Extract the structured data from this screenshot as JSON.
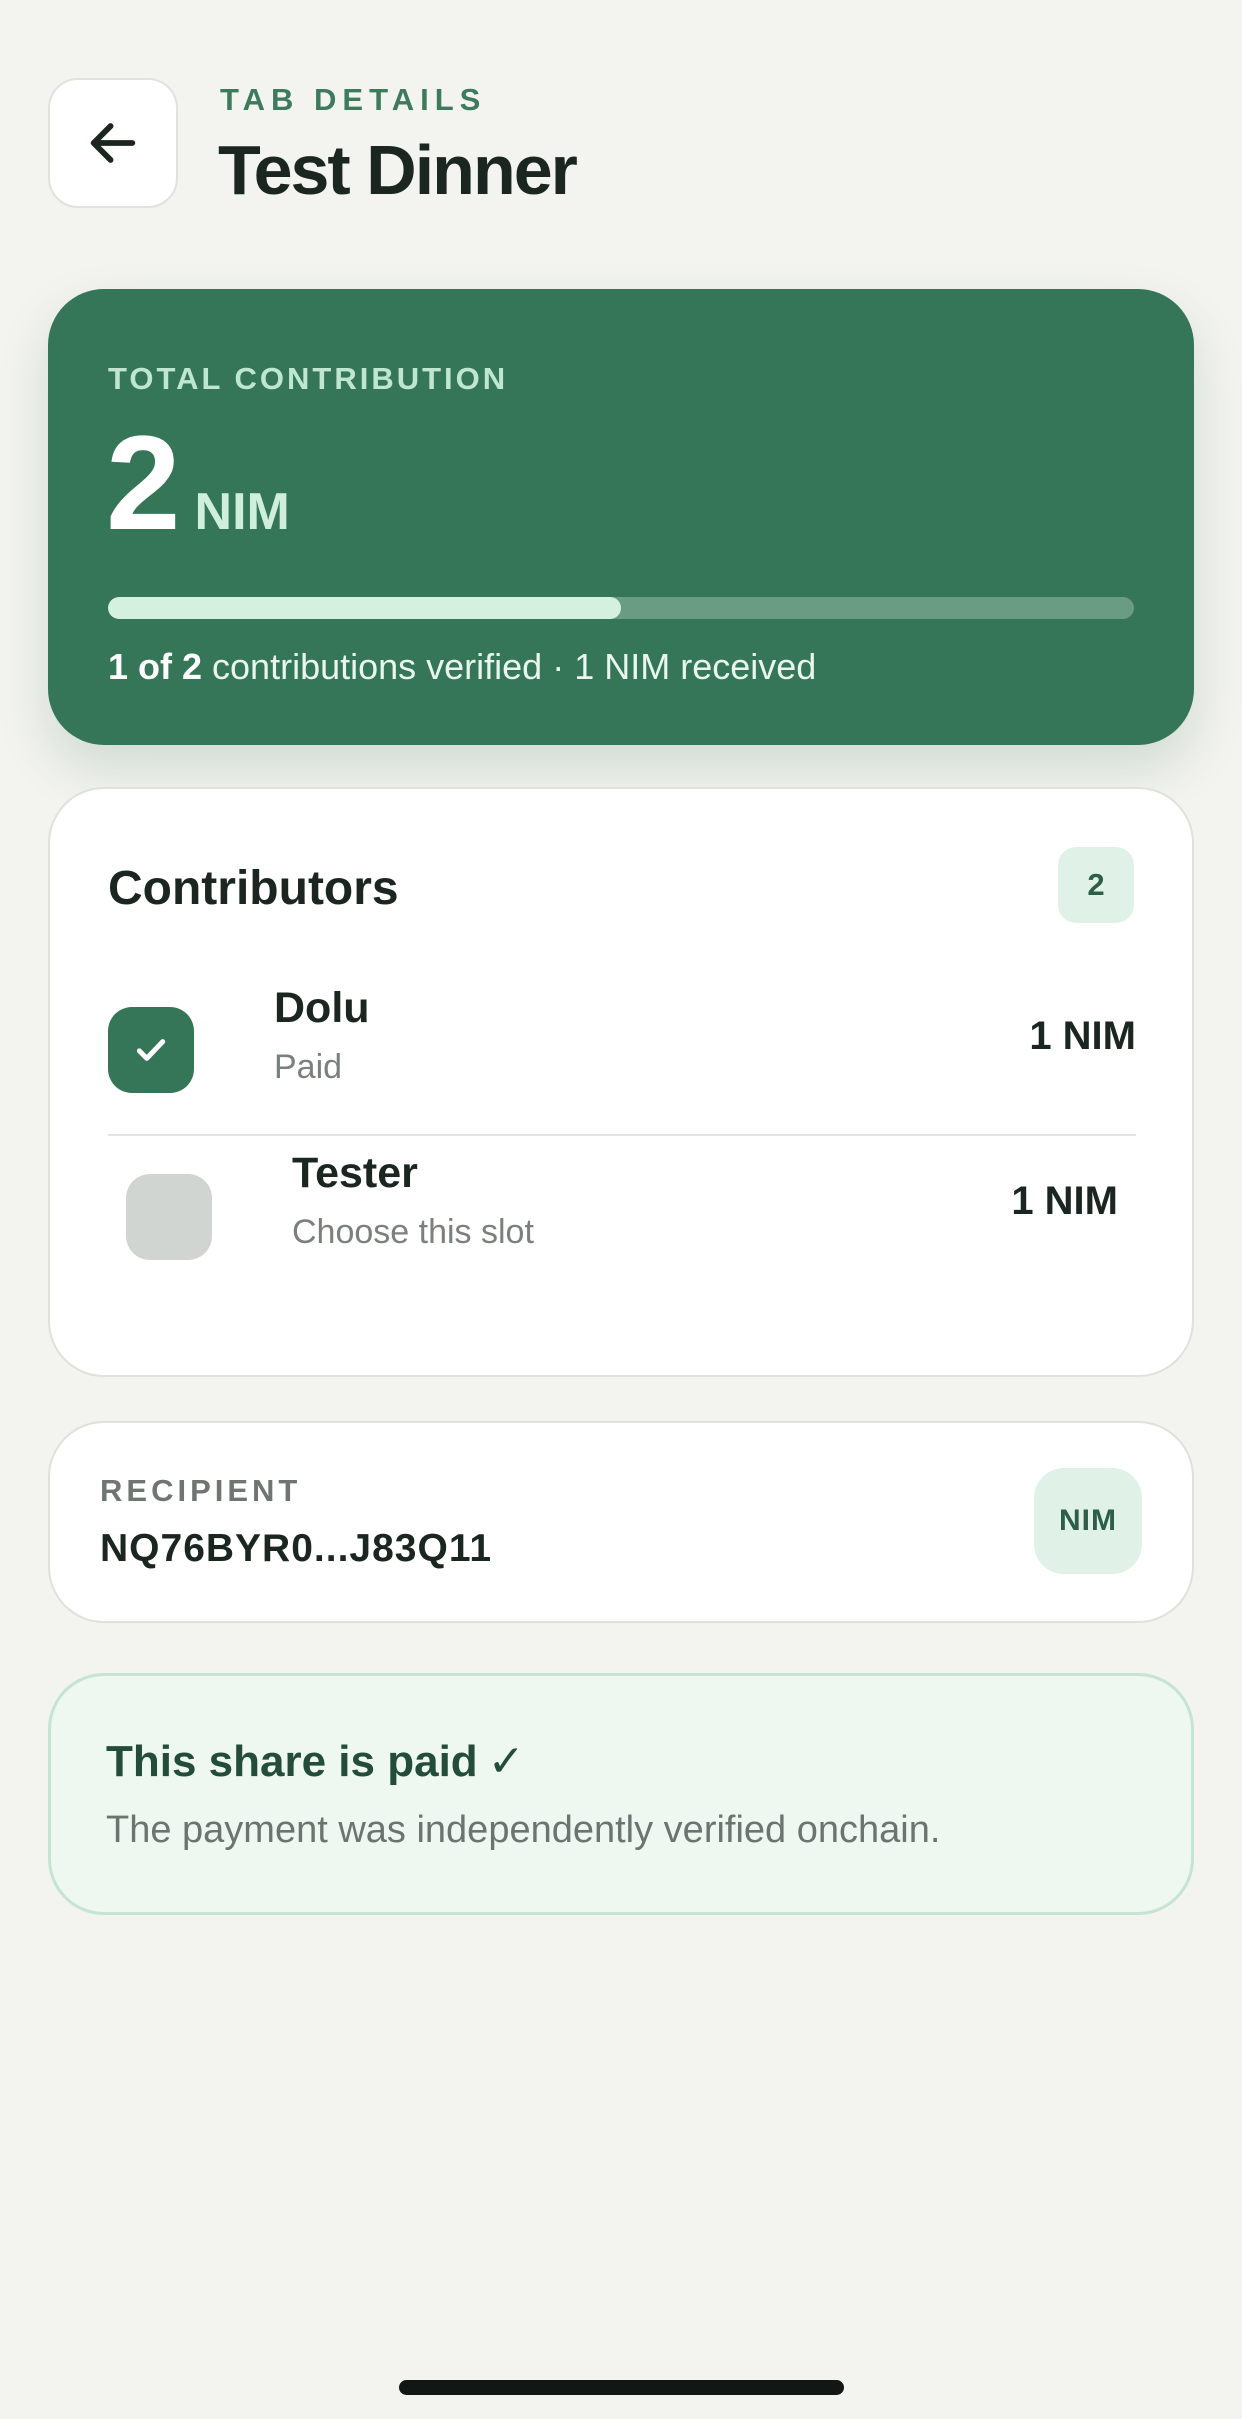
{
  "header": {
    "eyebrow": "TAB DETAILS",
    "title": "Test Dinner",
    "back_icon": "arrow-left-icon"
  },
  "total": {
    "label": "TOTAL CONTRIBUTION",
    "value": "2",
    "unit": "NIM",
    "progress_fraction": 0.5,
    "verified_count": "1 of 2",
    "verified_suffix": " contributions verified · 1 NIM received"
  },
  "contributors": {
    "title": "Contributors",
    "count": "2",
    "items": [
      {
        "name": "Dolu",
        "status": "Paid",
        "amount": "1 NIM",
        "checked": true
      },
      {
        "name": "Tester",
        "status": "Choose this slot",
        "amount": "1 NIM",
        "checked": false
      }
    ]
  },
  "recipient": {
    "label": "RECIPIENT",
    "address": "NQ76BYR0...J83Q11",
    "currency": "NIM"
  },
  "paid_notice": {
    "title": "This share is paid",
    "check": "✓",
    "text": "The payment was independently verified onchain."
  },
  "colors": {
    "accent": "#367658",
    "background": "#f3f3ef",
    "badge_bg": "#e0f2e7",
    "paid_bg": "#eef7f0"
  }
}
